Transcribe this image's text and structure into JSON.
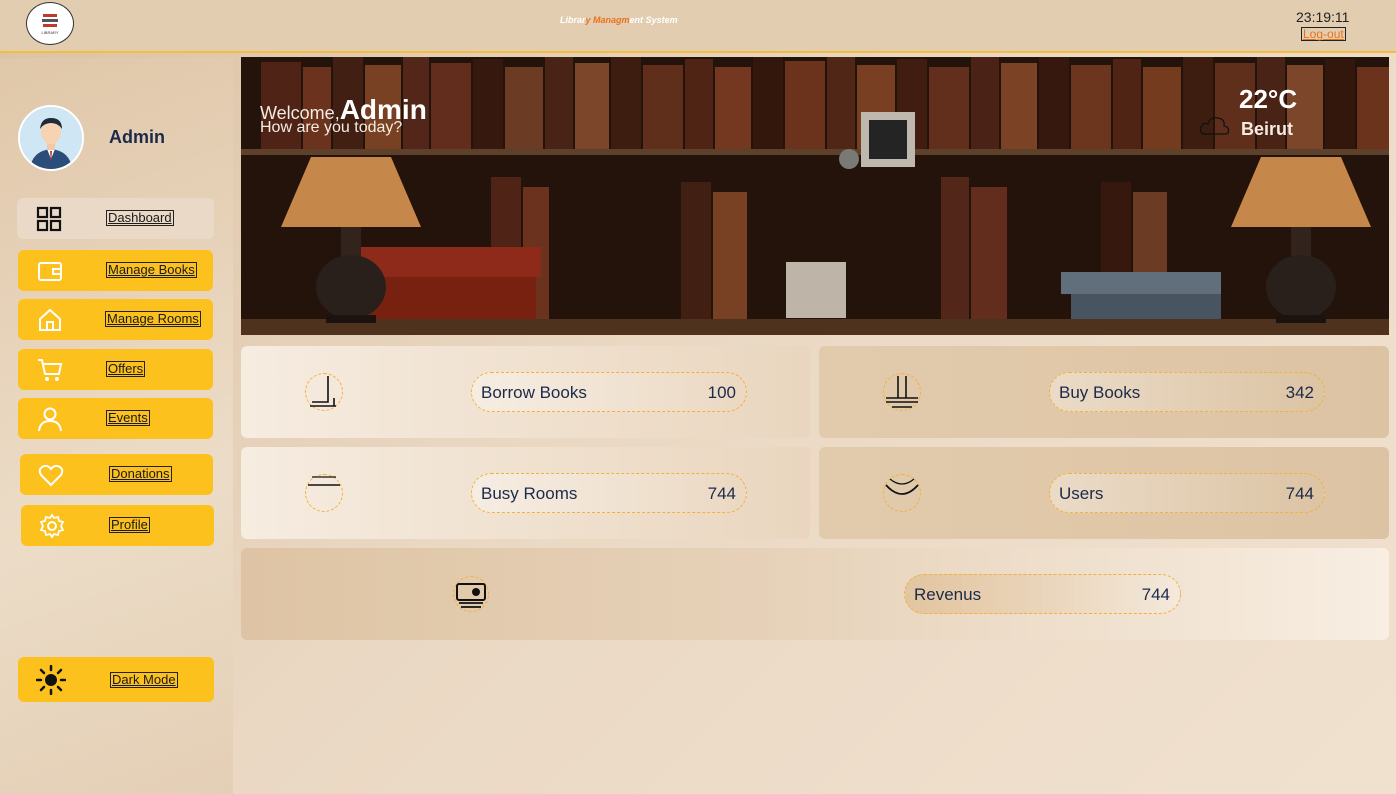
{
  "header": {
    "title_parts": [
      "Librar",
      "y ",
      "Managm",
      "ent ",
      "System"
    ],
    "clock": "23:19:11",
    "logout_label": "Log-out",
    "logo_text": "LIBRARY"
  },
  "sidebar": {
    "user_name": "Admin",
    "items": [
      {
        "label": "Dashboard",
        "icon": "grid-icon"
      },
      {
        "label": "Manage Books",
        "icon": "wallet-icon"
      },
      {
        "label": "Manage Rooms",
        "icon": "home-icon"
      },
      {
        "label": "Offers",
        "icon": "cart-icon"
      },
      {
        "label": "Events",
        "icon": "user-icon"
      },
      {
        "label": "Donations",
        "icon": "heart-icon"
      },
      {
        "label": "Profile",
        "icon": "gear-icon"
      }
    ],
    "dark_mode_label": "Dark Mode"
  },
  "banner": {
    "welcome": "Welcome,",
    "name": "Admin",
    "subtitle": "How are you today?",
    "temperature": "22°C",
    "city": "Beirut"
  },
  "stats": [
    {
      "label": "Borrow Books",
      "value": "100"
    },
    {
      "label": "Buy Books",
      "value": "342"
    },
    {
      "label": "Busy Rooms",
      "value": "744"
    },
    {
      "label": "Users",
      "value": "744"
    },
    {
      "label": "Revenus",
      "value": "744"
    }
  ],
  "colors": {
    "accent": "#fcc11d",
    "accent_orange": "#e8731c",
    "text_dark": "#1b2a4a"
  }
}
